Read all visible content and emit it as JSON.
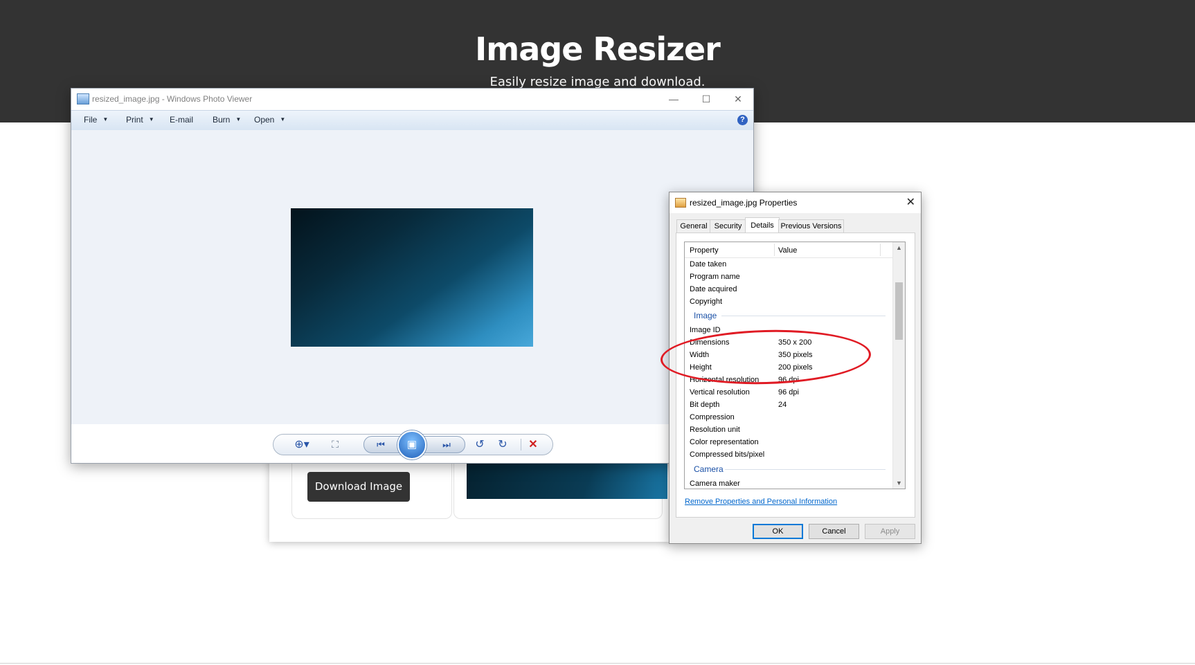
{
  "site": {
    "title": "Image Resizer",
    "subtitle": "Easily resize image and download."
  },
  "web_card": {
    "download_label": "Download Image"
  },
  "photo_viewer": {
    "title": "resized_image.jpg - Windows Photo Viewer",
    "window_controls": {
      "minimize": "—",
      "maximize": "☐",
      "close": "✕"
    },
    "menu": [
      "File",
      "Print",
      "E-mail",
      "Burn",
      "Open"
    ],
    "menu_has_dropdown": [
      true,
      true,
      false,
      true,
      true
    ],
    "help": "?",
    "toolbar": {
      "zoom": "⊕▾",
      "fit": "⛶",
      "previous": "⏮",
      "slideshow": "▣",
      "next": "⏭",
      "rotate_ccw": "↺",
      "rotate_cw": "↻",
      "delete": "✕"
    }
  },
  "properties": {
    "title": "resized_image.jpg Properties",
    "close": "✕",
    "tabs": [
      "General",
      "Security",
      "Details",
      "Previous Versions"
    ],
    "active_tab": "Details",
    "columns": {
      "property": "Property",
      "value": "Value"
    },
    "rows_top": [
      {
        "property": "Date taken",
        "value": ""
      },
      {
        "property": "Program name",
        "value": ""
      },
      {
        "property": "Date acquired",
        "value": ""
      },
      {
        "property": "Copyright",
        "value": ""
      }
    ],
    "group_image": "Image",
    "rows_image": [
      {
        "property": "Image ID",
        "value": ""
      },
      {
        "property": "Dimensions",
        "value": "350 x 200"
      },
      {
        "property": "Width",
        "value": "350 pixels"
      },
      {
        "property": "Height",
        "value": "200 pixels"
      },
      {
        "property": "Horizontal resolution",
        "value": "96 dpi"
      },
      {
        "property": "Vertical resolution",
        "value": "96 dpi"
      },
      {
        "property": "Bit depth",
        "value": "24"
      },
      {
        "property": "Compression",
        "value": ""
      },
      {
        "property": "Resolution unit",
        "value": ""
      },
      {
        "property": "Color representation",
        "value": ""
      },
      {
        "property": "Compressed bits/pixel",
        "value": ""
      }
    ],
    "group_camera": "Camera",
    "rows_camera": [
      {
        "property": "Camera maker",
        "value": ""
      }
    ],
    "scroll": {
      "up": "▲",
      "down": "▼"
    },
    "remove_link": "Remove Properties and Personal Information",
    "buttons": {
      "ok": "OK",
      "cancel": "Cancel",
      "apply": "Apply"
    }
  },
  "colors": {
    "header_bg": "#333333",
    "accent_blue": "#0078d7",
    "annotation_red": "#e01b24",
    "group_blue": "#1a50a6"
  }
}
